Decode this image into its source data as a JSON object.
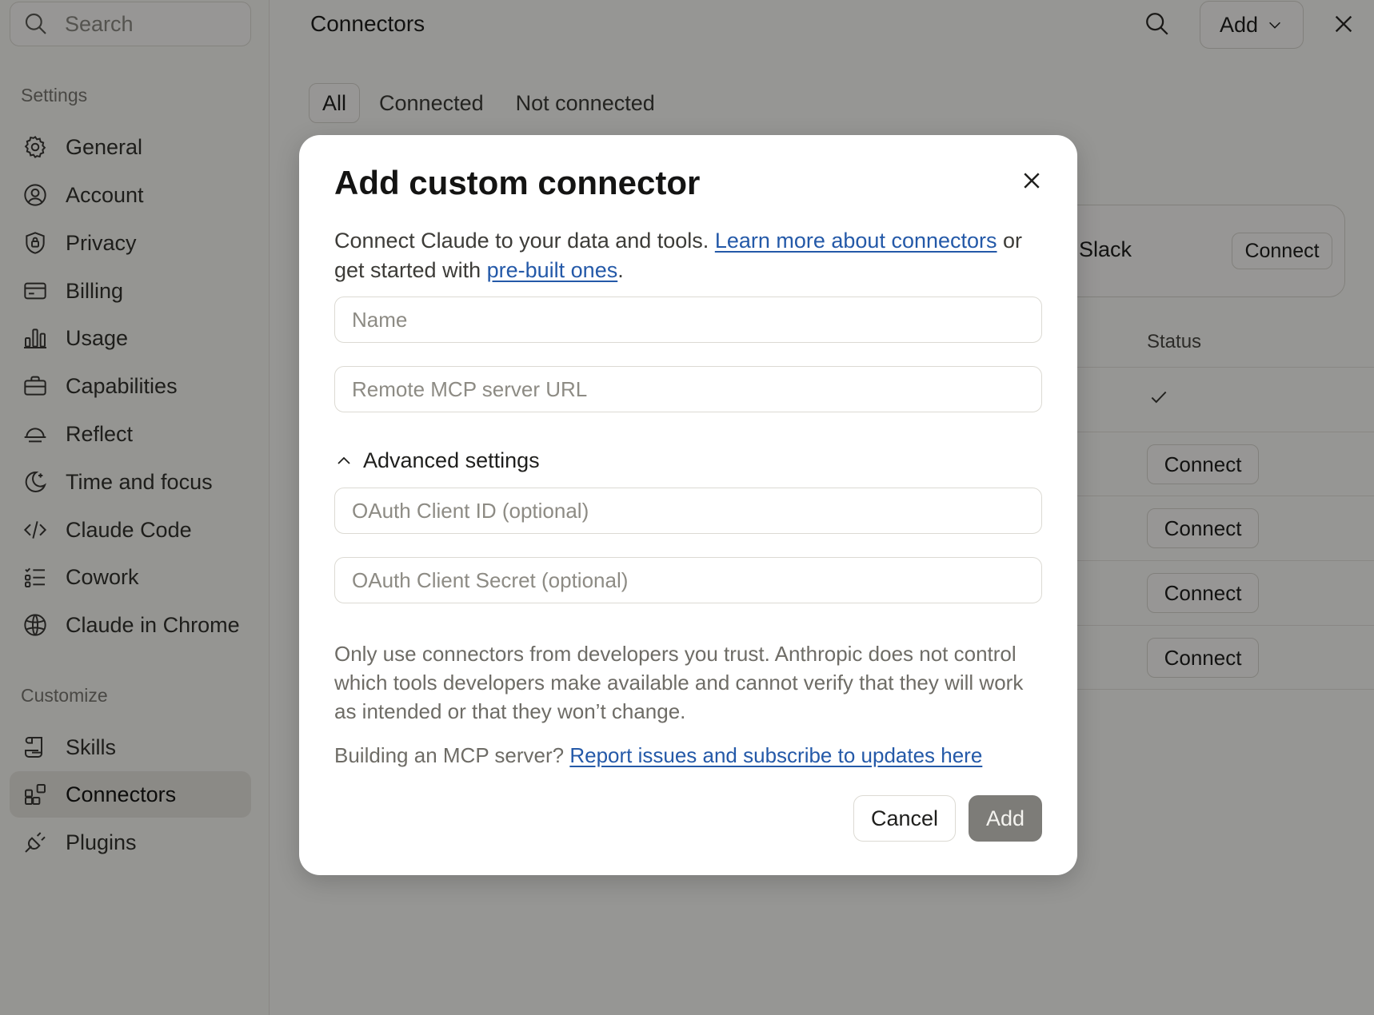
{
  "sidebar": {
    "search_placeholder": "Search",
    "settings_label": "Settings",
    "settings_items": [
      {
        "label": "General",
        "icon": "gear-icon"
      },
      {
        "label": "Account",
        "icon": "user-circle-icon"
      },
      {
        "label": "Privacy",
        "icon": "shield-lock-icon"
      },
      {
        "label": "Billing",
        "icon": "credit-card-icon"
      },
      {
        "label": "Usage",
        "icon": "bar-chart-icon"
      },
      {
        "label": "Capabilities",
        "icon": "toolbox-icon"
      },
      {
        "label": "Reflect",
        "icon": "sunrise-icon"
      },
      {
        "label": "Time and focus",
        "icon": "moon-sparkle-icon"
      },
      {
        "label": "Claude Code",
        "icon": "code-icon"
      },
      {
        "label": "Cowork",
        "icon": "checklist-icon"
      },
      {
        "label": "Claude in Chrome",
        "icon": "globe-icon"
      }
    ],
    "customize_label": "Customize",
    "customize_items": [
      {
        "label": "Skills",
        "icon": "scroll-icon"
      },
      {
        "label": "Connectors",
        "icon": "connector-blocks-icon",
        "active": true
      },
      {
        "label": "Plugins",
        "icon": "plug-icon"
      }
    ]
  },
  "header": {
    "title": "Connectors",
    "add_label": "Add"
  },
  "tabs": [
    "All",
    "Connected",
    "Not connected"
  ],
  "background": {
    "slack_name": "Slack",
    "slack_connect": "Connect",
    "status_header": "Status",
    "row_connect_label": "Connect"
  },
  "modal": {
    "title": "Add custom connector",
    "desc_prefix": "Connect Claude to your data and tools. ",
    "desc_link1": "Learn more about connectors",
    "desc_middle": " or get started with ",
    "desc_link2": "pre-built ones",
    "desc_suffix": ".",
    "name_placeholder": "Name",
    "url_placeholder": "Remote MCP server URL",
    "advanced_label": "Advanced settings",
    "client_id_placeholder": "OAuth Client ID (optional)",
    "client_secret_placeholder": "OAuth Client Secret (optional)",
    "disclaimer": "Only use connectors from developers you trust. Anthropic does not control which tools developers make available and cannot verify that they will work as intended or that they won’t change.",
    "mcp_prefix": "Building an MCP server? ",
    "mcp_link": "Report issues and subscribe to updates here",
    "cancel_label": "Cancel",
    "add_label": "Add"
  }
}
